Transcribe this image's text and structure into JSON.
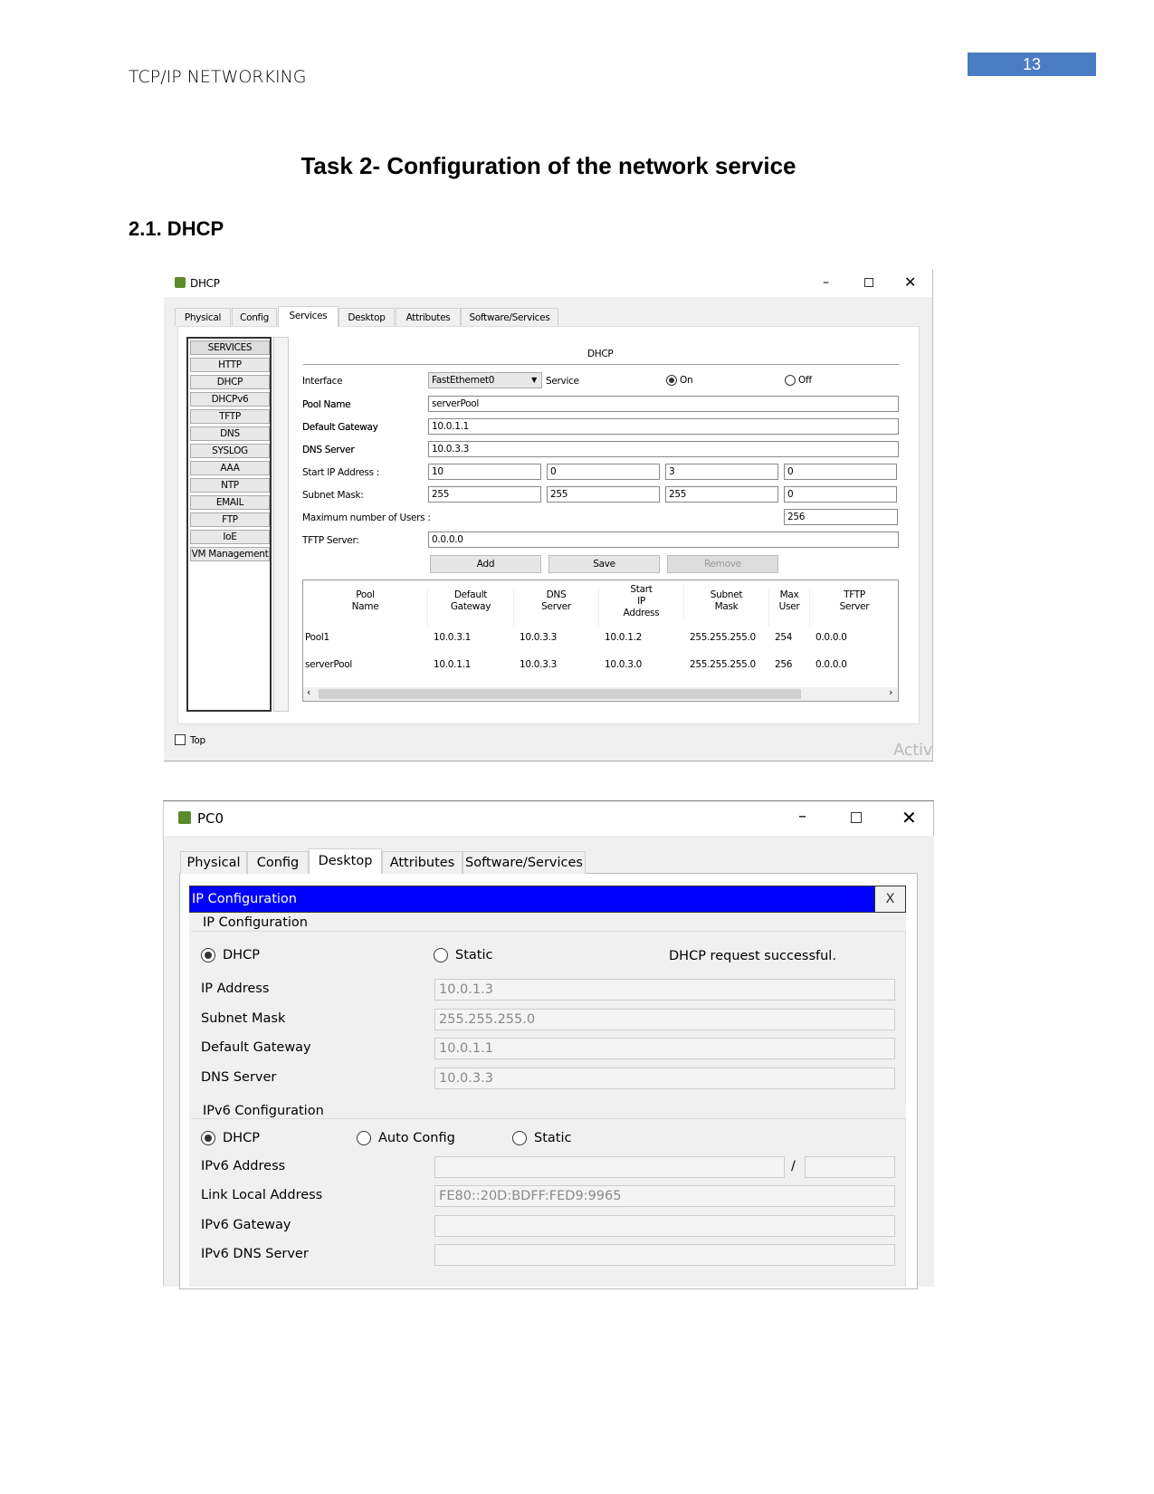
{
  "header": {
    "running_title": "TCP/IP NETWORKING",
    "page_number": "13"
  },
  "title": "Task 2- Configuration of the network service",
  "section": "2.1. DHCP",
  "dhcp_window": {
    "title": "DHCP",
    "tabs": [
      "Physical",
      "Config",
      "Services",
      "Desktop",
      "Attributes",
      "Software/Services"
    ],
    "selected_tab": "Services",
    "services": [
      "SERVICES",
      "HTTP",
      "DHCP",
      "DHCPv6",
      "TFTP",
      "DNS",
      "SYSLOG",
      "AAA",
      "NTP",
      "EMAIL",
      "FTP",
      "IoE",
      "VM Management"
    ],
    "panel_title": "DHCP",
    "interface_label": "Interface",
    "interface_value": "FastEthernet0",
    "service_label": "Service",
    "on_label": "On",
    "off_label": "Off",
    "service_state": "On",
    "pool_name_label": "Pool Name",
    "pool_name": "serverPool",
    "gateway_label": "Default Gateway",
    "gateway": "10.0.1.1",
    "dns_label": "DNS Server",
    "dns": "10.0.3.3",
    "start_ip_label": "Start IP Address :",
    "start_ip": [
      "10",
      "0",
      "3",
      "0"
    ],
    "subnet_label": "Subnet Mask:",
    "subnet": [
      "255",
      "255",
      "255",
      "0"
    ],
    "max_users_label": "Maximum number of Users :",
    "max_users": "256",
    "tftp_label": "TFTP Server:",
    "tftp": "0.0.0.0",
    "add": "Add",
    "save": "Save",
    "remove": "Remove",
    "table_headers": [
      "Pool\nName",
      "Default\nGateway",
      "DNS\nServer",
      "Start\nIP\nAddress",
      "Subnet\nMask",
      "Max\nUser",
      "TFTP\nServer"
    ],
    "rows": [
      [
        "Pool1",
        "10.0.3.1",
        "10.0.3.3",
        "10.0.1.2",
        "255.255.255.0",
        "254",
        "0.0.0.0"
      ],
      [
        "serverPool",
        "10.0.1.1",
        "10.0.3.3",
        "10.0.3.0",
        "255.255.255.0",
        "256",
        "0.0.0.0"
      ]
    ],
    "top_label": "Top",
    "watermark": "Activ"
  },
  "pc_window": {
    "title": "PC0",
    "tabs": [
      "Physical",
      "Config",
      "Desktop",
      "Attributes",
      "Software/Services"
    ],
    "selected_tab": "Desktop",
    "bar_title": "IP Configuration",
    "bar_color": "#0000ff",
    "close": "X",
    "ipv4_group": "IP Configuration",
    "dhcp": "DHCP",
    "static": "Static",
    "mode": "DHCP",
    "status": "DHCP request successful.",
    "fields": [
      {
        "label": "IP Address",
        "value": "10.0.1.3"
      },
      {
        "label": "Subnet Mask",
        "value": "255.255.255.0"
      },
      {
        "label": "Default Gateway",
        "value": "10.0.1.1"
      },
      {
        "label": "DNS Server",
        "value": "10.0.3.3"
      }
    ],
    "ipv6_group": "IPv6 Configuration",
    "v6_dhcp": "DHCP",
    "v6_auto": "Auto Config",
    "v6_static": "Static",
    "ipv6_address_label": "IPv6 Address",
    "slash": "/",
    "link_local_label": "Link Local Address",
    "link_local": "FE80::20D:BDFF:FED9:9965",
    "ipv6_gateway_label": "IPv6 Gateway",
    "ipv6_dns_label": "IPv6 DNS Server"
  }
}
